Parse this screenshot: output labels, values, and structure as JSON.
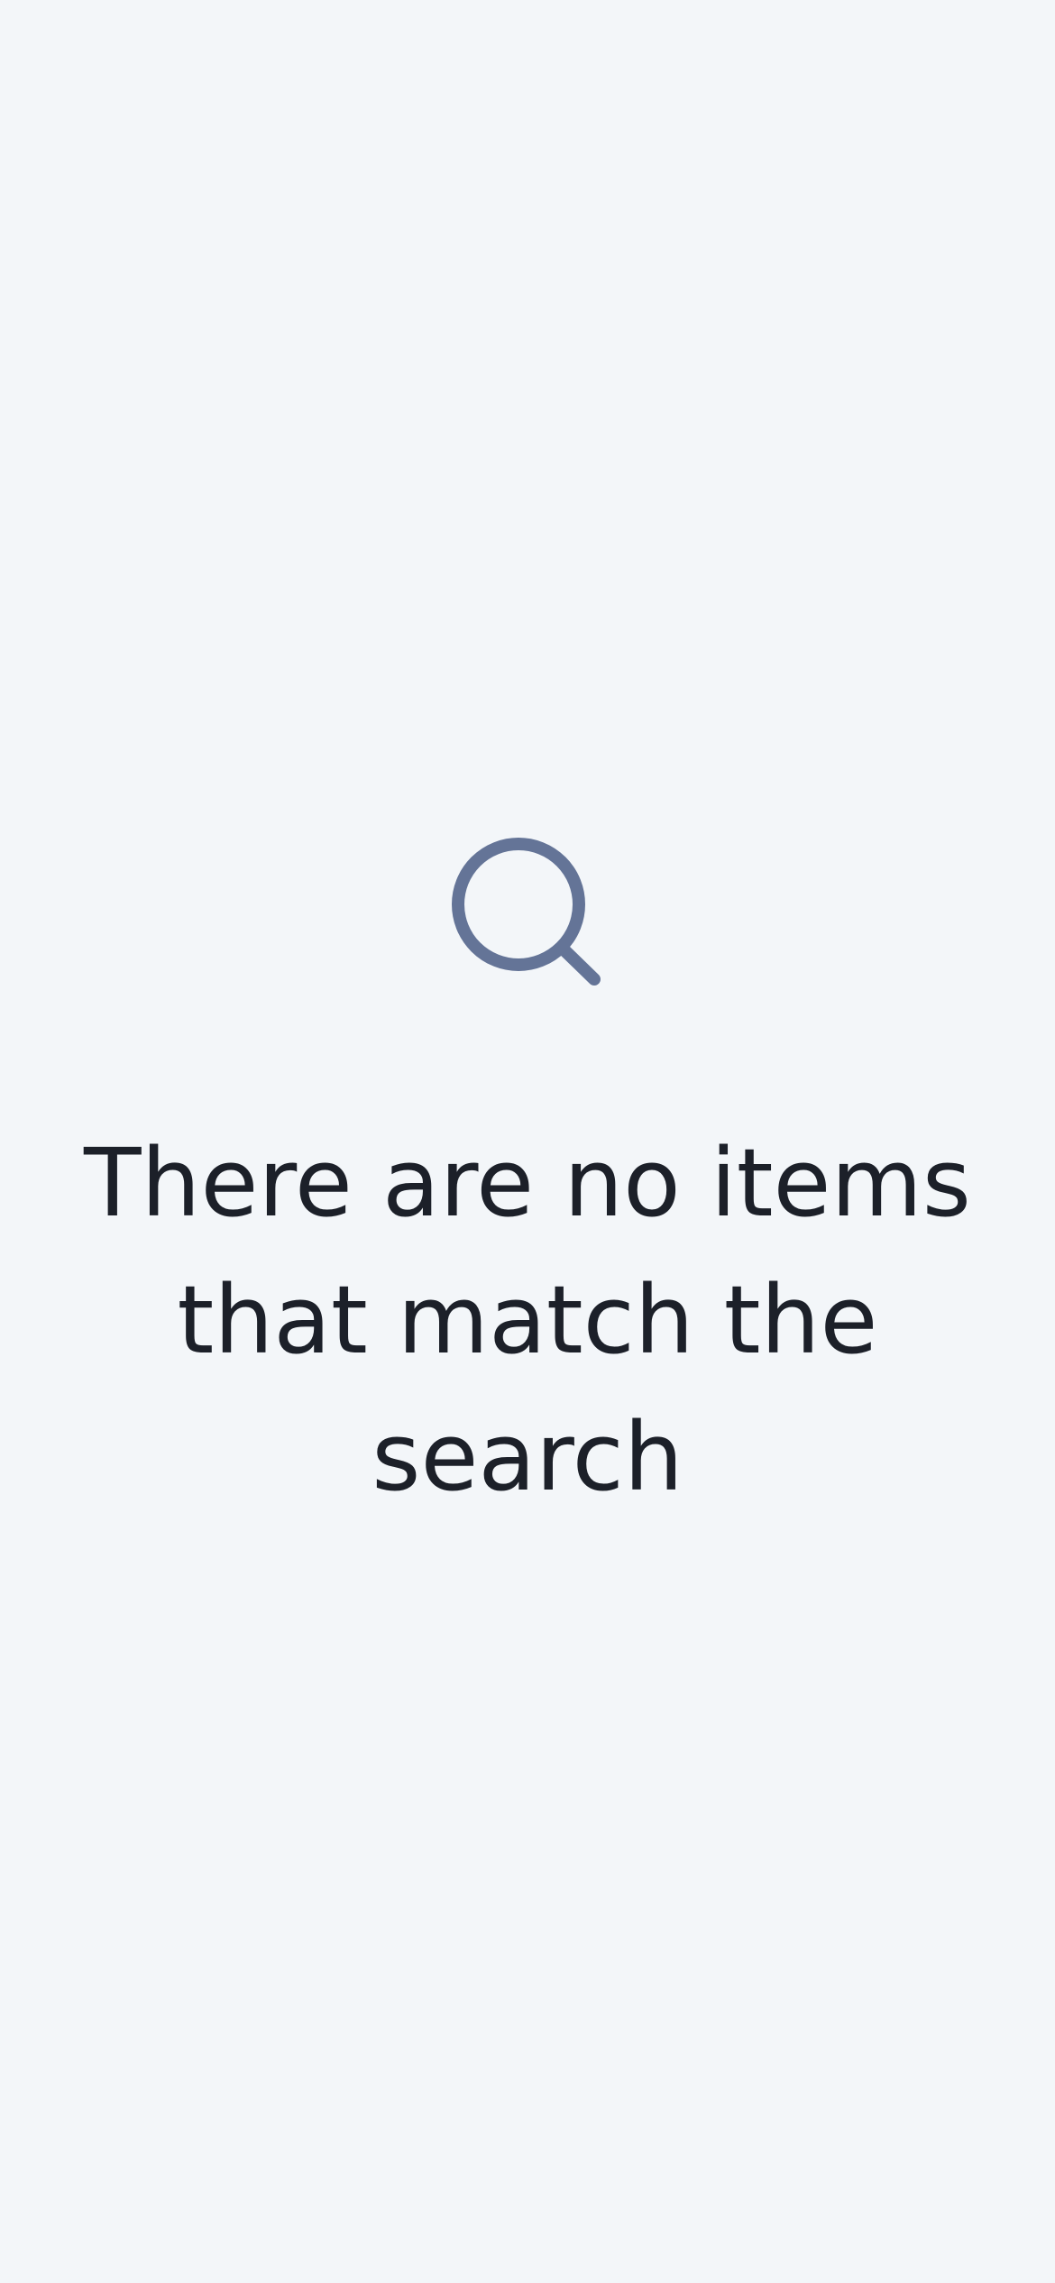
{
  "empty_state": {
    "icon": "search-icon",
    "message": "There are no items that match the search"
  },
  "colors": {
    "background": "#f3f6f9",
    "icon": "#647497",
    "text": "#1c2029"
  }
}
